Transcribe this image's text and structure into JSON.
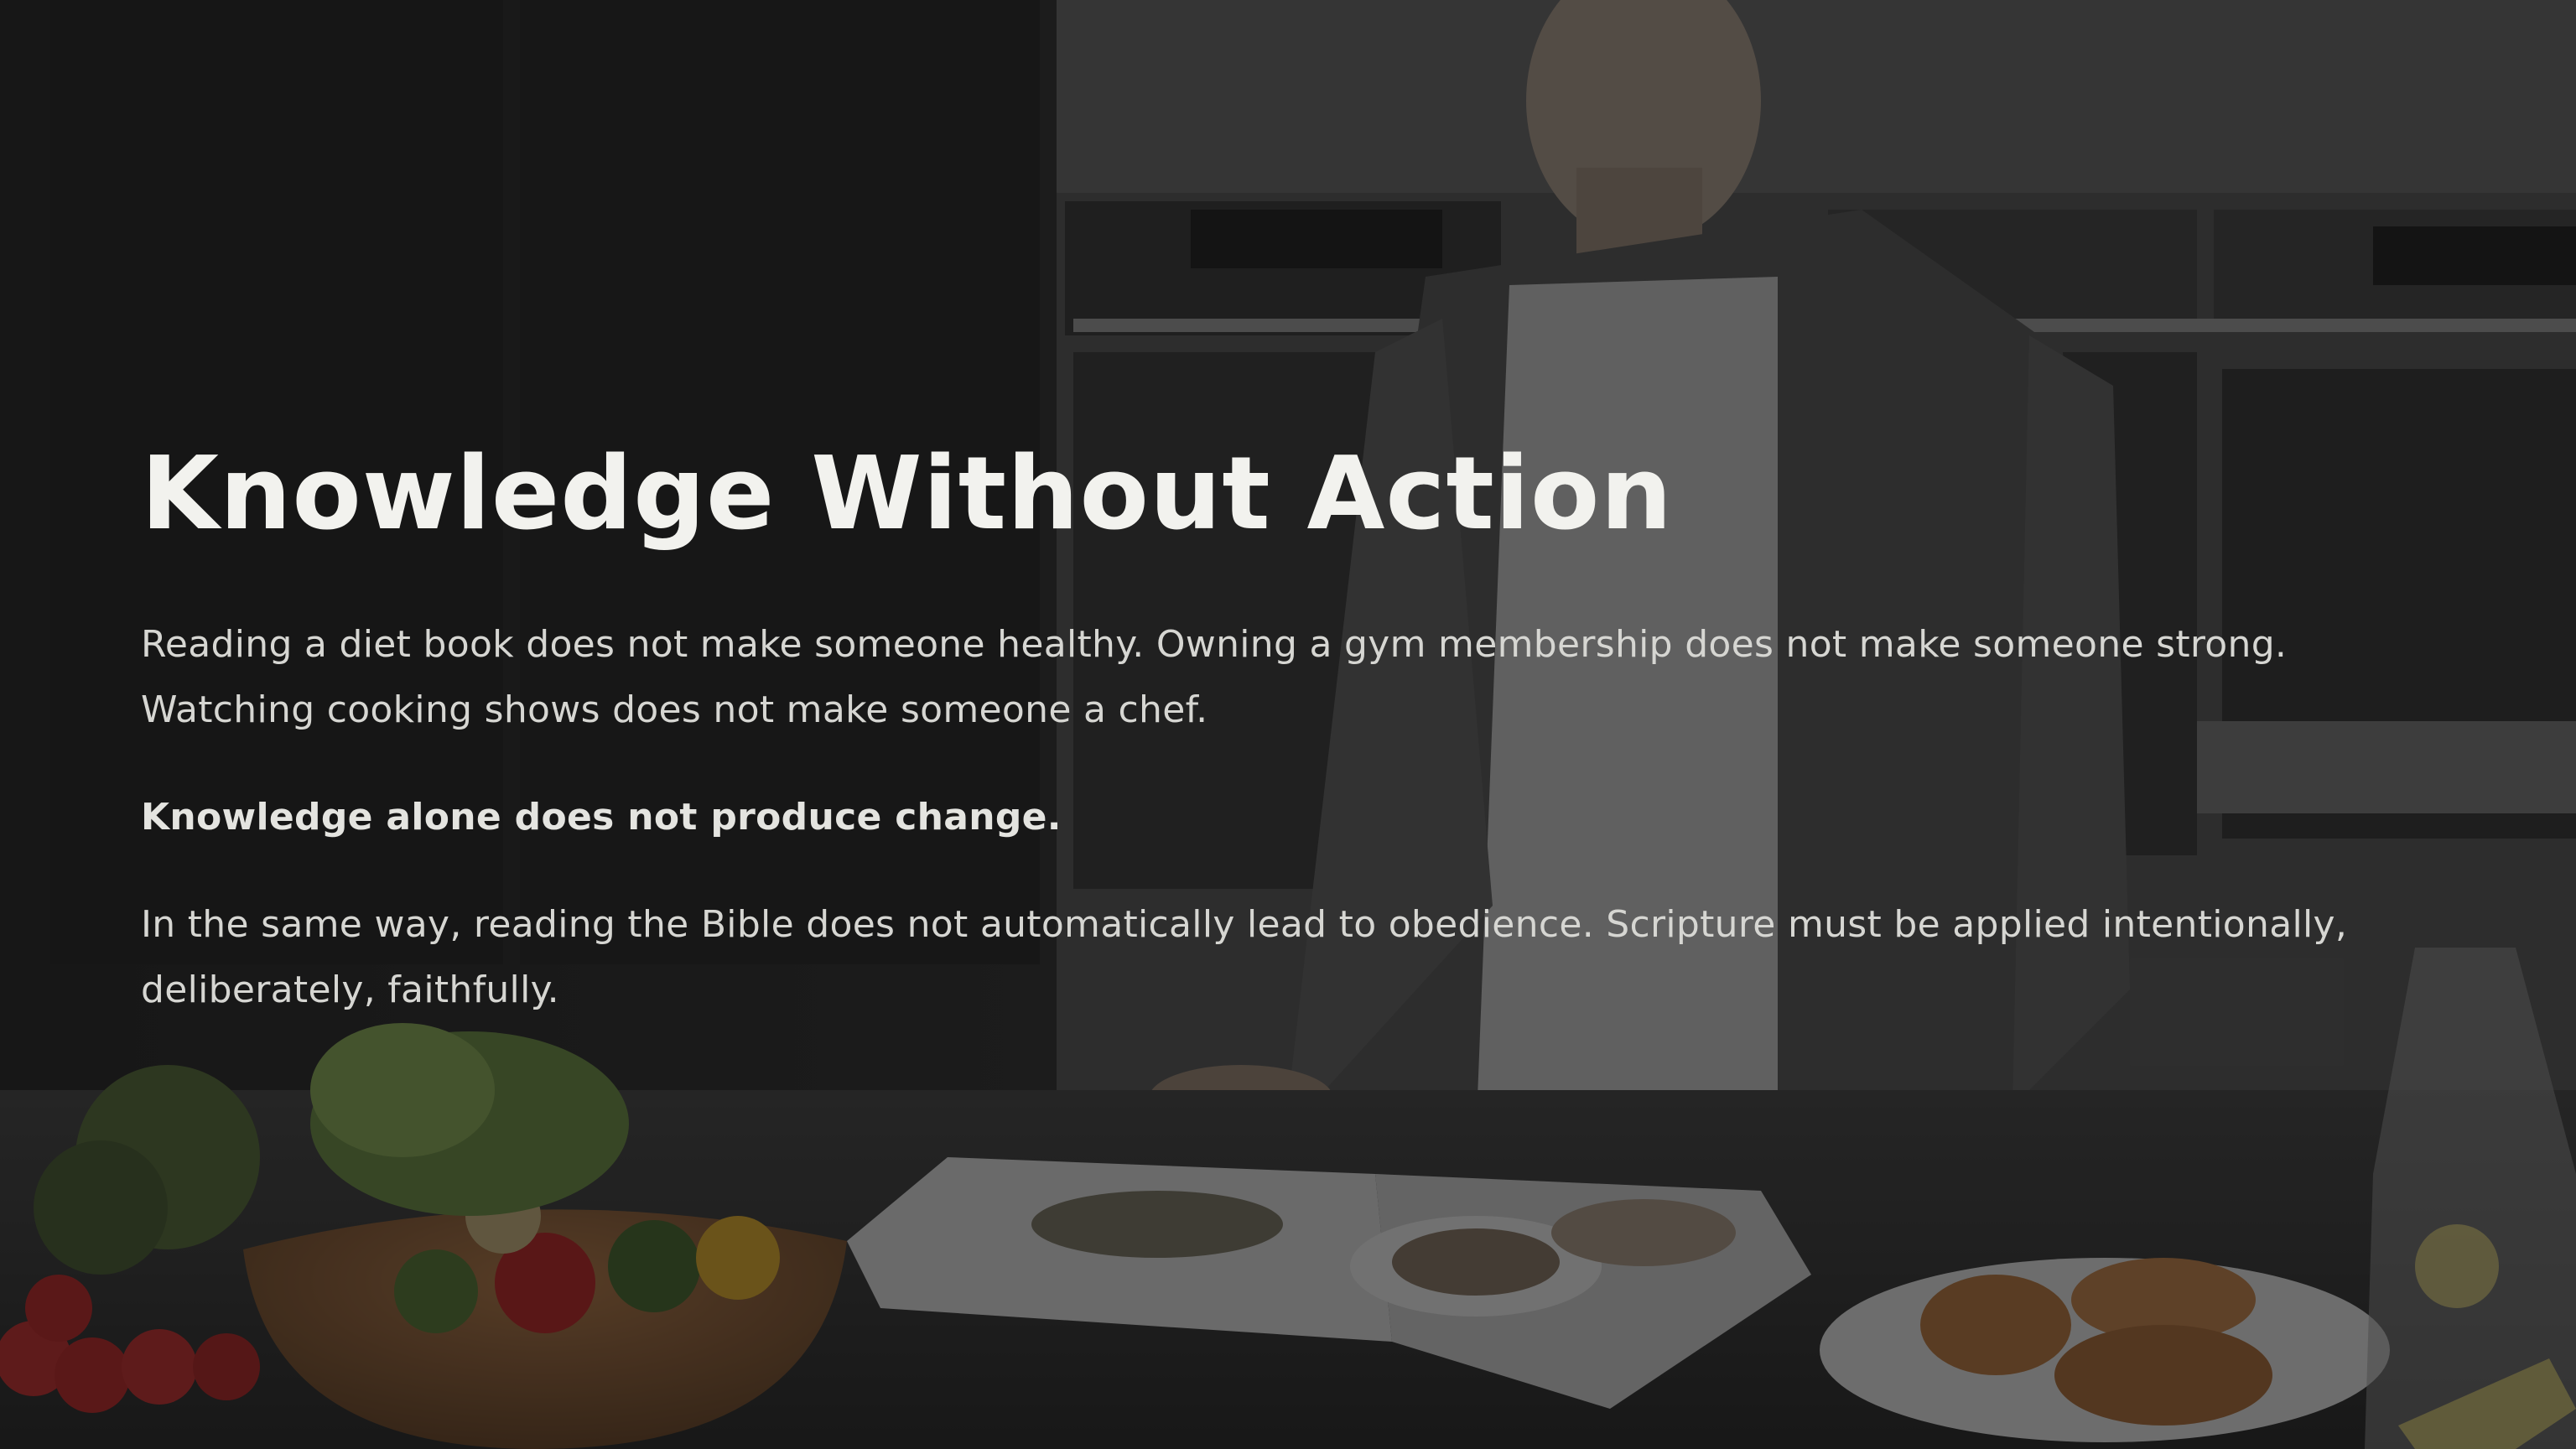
{
  "slide": {
    "title": "Knowledge Without Action",
    "paragraphs": [
      "Reading a diet book does not make someone healthy. Owning a gym membership does not make someone strong. Watching cooking shows does not make someone a chef.",
      "Knowledge alone does not produce change.",
      "In the same way, reading the Bible does not automatically lead to obedience. Scripture must be applied intentionally, deliberately, faithfully."
    ]
  },
  "colors": {
    "title": "#f2f2ee",
    "body_text": "#d6d6d2",
    "overlay": "#141414"
  }
}
